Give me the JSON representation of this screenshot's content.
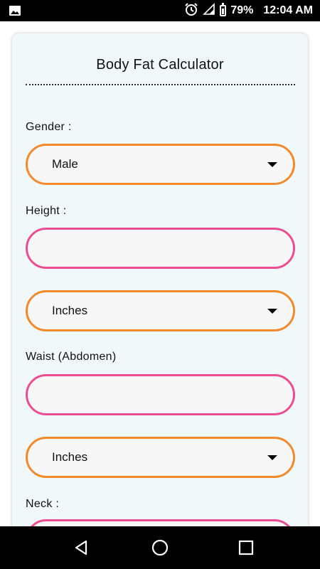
{
  "status_bar": {
    "battery": "79%",
    "time": "12:04 AM",
    "icons": [
      "image-icon",
      "alarm-icon",
      "signal-icon",
      "battery-icon"
    ]
  },
  "app": {
    "title": "Body Fat Calculator"
  },
  "form": {
    "gender": {
      "label": "Gender :",
      "selected": "Male"
    },
    "height": {
      "label": "Height :",
      "value": "",
      "unit": "Inches"
    },
    "waist": {
      "label": "Waist (Abdomen)",
      "value": "",
      "unit": "Inches"
    },
    "neck": {
      "label": "Neck :",
      "value": ""
    }
  },
  "colors": {
    "select_border": "#f28a2c",
    "input_border": "#ec4d92",
    "card_background": "#f1f8f9"
  },
  "nav_bar": {
    "icons": [
      "back-icon",
      "home-icon",
      "recents-icon"
    ]
  }
}
